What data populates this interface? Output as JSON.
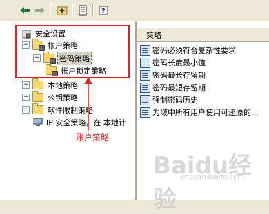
{
  "tree": {
    "root": "安全设置",
    "account_policy": "帐户策略",
    "password_policy": "密码策略",
    "lockout_policy": "帐户锁定策略",
    "local_policy": "本地策略",
    "public_key_policy": "公钥策略",
    "software_restriction": "软件限制策略",
    "ip_security": "IP 安全策略，在 本地计"
  },
  "list": {
    "header": "策略",
    "items": [
      "密码必须符合复杂性要求",
      "密码长度最小值",
      "密码最长存留期",
      "密码最短存留期",
      "强制密码历史",
      "为域中所有用户使用可还原的..."
    ]
  },
  "annotation": "账户策略",
  "watermark": {
    "main": "Baidu经验",
    "sub": "jingyan.baidu.com"
  },
  "colors": {
    "annotation": "#e02020",
    "selection": "#d8d4c8"
  }
}
